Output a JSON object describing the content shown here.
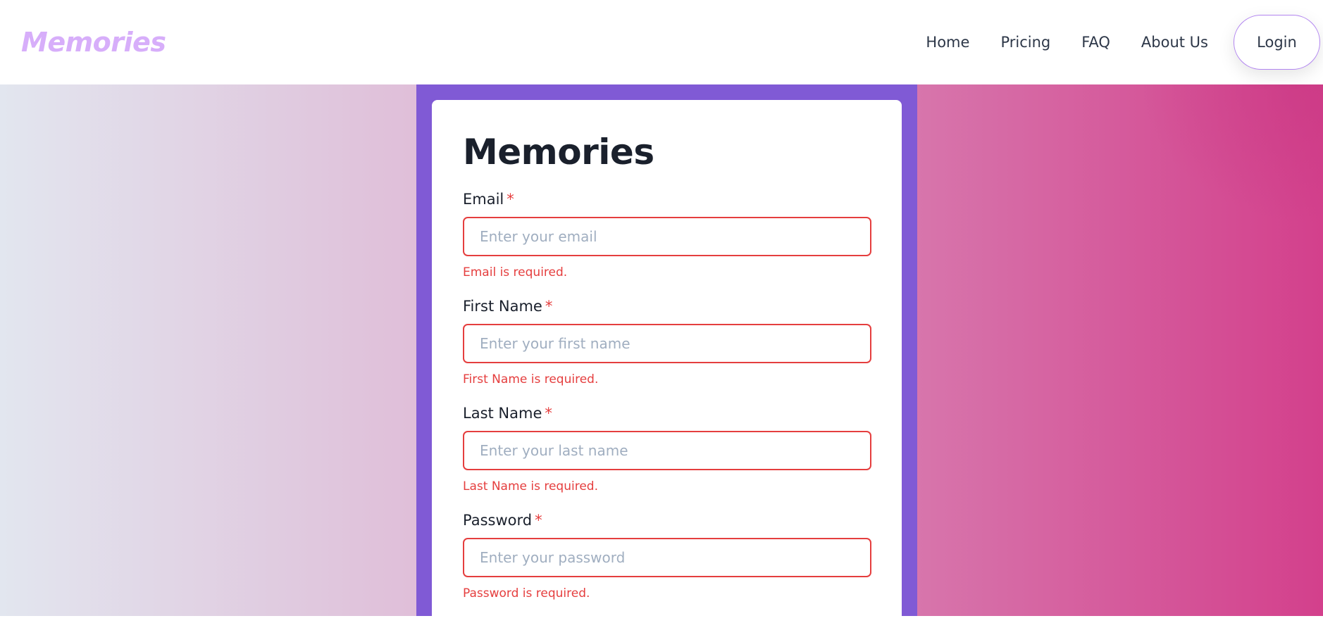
{
  "header": {
    "brand": "Memories",
    "nav": [
      "Home",
      "Pricing",
      "FAQ",
      "About Us"
    ],
    "login_label": "Login"
  },
  "form": {
    "title": "Memories",
    "required_marker": "*",
    "fields": [
      {
        "label": "Email",
        "placeholder": "Enter your email",
        "value": "",
        "error": "Email is required."
      },
      {
        "label": "First Name",
        "placeholder": "Enter your first name",
        "value": "",
        "error": "First Name is required."
      },
      {
        "label": "Last Name",
        "placeholder": "Enter your last name",
        "value": "",
        "error": "Last Name is required."
      },
      {
        "label": "Password",
        "placeholder": "Enter your password",
        "value": "",
        "error": "Password is required."
      }
    ]
  },
  "colors": {
    "brand": "#d7aefa",
    "panel": "#805ad5",
    "error": "#e53e3e",
    "gradient_start": "#e2e6ef",
    "gradient_end": "#d3408c"
  }
}
